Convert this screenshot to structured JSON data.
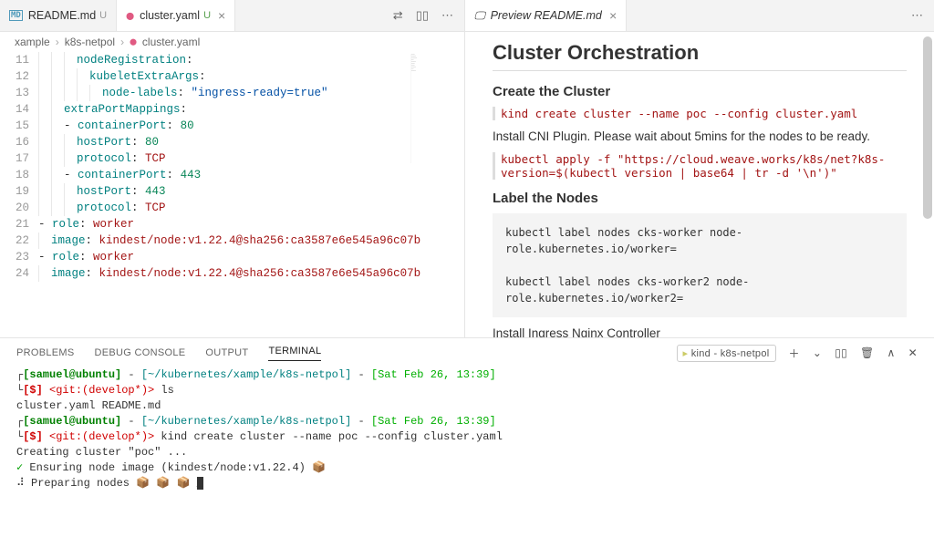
{
  "tabs": {
    "left": [
      {
        "icon": "MD",
        "iconColor": "#519aba",
        "label": "README.md",
        "mod": "U",
        "modColor": "#999"
      },
      {
        "icon": "⬤",
        "iconColor": "#e05a82",
        "label": "cluster.yaml",
        "mod": "U",
        "modColor": "#59a14f"
      }
    ],
    "right": {
      "icon": "🖵",
      "label": "Preview README.md"
    },
    "actions": {
      "compare": "⇄",
      "split": "▯▯",
      "more": "⋯"
    }
  },
  "breadcrumb": {
    "seg1": "xample",
    "seg2": "k8s-netpol",
    "seg3": "cluster.yaml",
    "fileIcon": "⬤"
  },
  "editor": {
    "startLine": 11,
    "lines": [
      {
        "n": 11,
        "indent": 3,
        "k": "nodeRegistration",
        "rest": ":"
      },
      {
        "n": 12,
        "indent": 4,
        "k": "kubeletExtraArgs",
        "rest": ":"
      },
      {
        "n": 13,
        "indent": 5,
        "k": "node-labels",
        "rest": ": ",
        "str": "\"ingress-ready=true\""
      },
      {
        "n": 14,
        "indent": 2,
        "k": "extraPortMappings",
        "rest": ":"
      },
      {
        "n": 15,
        "indent": 2,
        "dash": true,
        "k": "containerPort",
        "rest": ": ",
        "num": "80"
      },
      {
        "n": 16,
        "indent": 3,
        "k": "hostPort",
        "rest": ": ",
        "num": "80"
      },
      {
        "n": 17,
        "indent": 3,
        "k": "protocol",
        "rest": ": ",
        "kw": "TCP"
      },
      {
        "n": 18,
        "indent": 2,
        "dash": true,
        "k": "containerPort",
        "rest": ": ",
        "num": "443"
      },
      {
        "n": 19,
        "indent": 3,
        "k": "hostPort",
        "rest": ": ",
        "num": "443"
      },
      {
        "n": 20,
        "indent": 3,
        "k": "protocol",
        "rest": ": ",
        "kw": "TCP"
      },
      {
        "n": 21,
        "indent": 0,
        "dash": true,
        "k": "role",
        "rest": ": ",
        "kw": "worker"
      },
      {
        "n": 22,
        "indent": 1,
        "k": "image",
        "rest": ": ",
        "kw": "kindest/node:v1.22.4@sha256:ca3587e6e545a96c07b"
      },
      {
        "n": 23,
        "indent": 0,
        "dash": true,
        "k": "role",
        "rest": ": ",
        "kw": "worker"
      },
      {
        "n": 24,
        "indent": 1,
        "k": "image",
        "rest": ": ",
        "kw": "kindest/node:v1.22.4@sha256:ca3587e6e545a96c07b"
      }
    ]
  },
  "preview": {
    "title": "Cluster Orchestration",
    "h3_create": "Create the Cluster",
    "cmd_create": "kind create cluster --name poc --config cluster.yaml",
    "p_cni": "Install CNI Plugin. Please wait about 5mins for the nodes to be ready.",
    "cmd_cni": "kubectl apply -f \"https://cloud.weave.works/k8s/net?k8s-version=$(kubectl version | base64 | tr -d '\\n')\"",
    "h3_label": "Label the Nodes",
    "codeblock": "kubectl label nodes cks-worker node-role.kubernetes.io/worker=\n\nkubectl label nodes cks-worker2 node-role.kubernetes.io/worker2=",
    "p_ingress": "Install Ingress Nginx Controller"
  },
  "panel": {
    "tabs": [
      "PROBLEMS",
      "DEBUG CONSOLE",
      "OUTPUT",
      "TERMINAL"
    ],
    "termSelect": "kind - k8s-netpol",
    "icons": {
      "add": "＋",
      "chev": "⌄",
      "split": "▯▯",
      "trash": "🗑",
      "up": "∧",
      "close": "✕"
    }
  },
  "terminal": {
    "prompt": {
      "user": "samuel",
      "host": "ubuntu",
      "path": "~/kubernetes/xample/k8s-netpol",
      "date": "Sat Feb 26, 13:39",
      "git": "develop*"
    },
    "lines": {
      "cmd1": "ls",
      "out1": "cluster.yaml  README.md",
      "cmd2": "kind create cluster --name poc --config cluster.yaml",
      "out2": "Creating cluster \"poc\" ...",
      "out3": "Ensuring node image (kindest/node:v1.22.4) 📦",
      "out4": "Preparing nodes 📦 📦 📦"
    }
  }
}
